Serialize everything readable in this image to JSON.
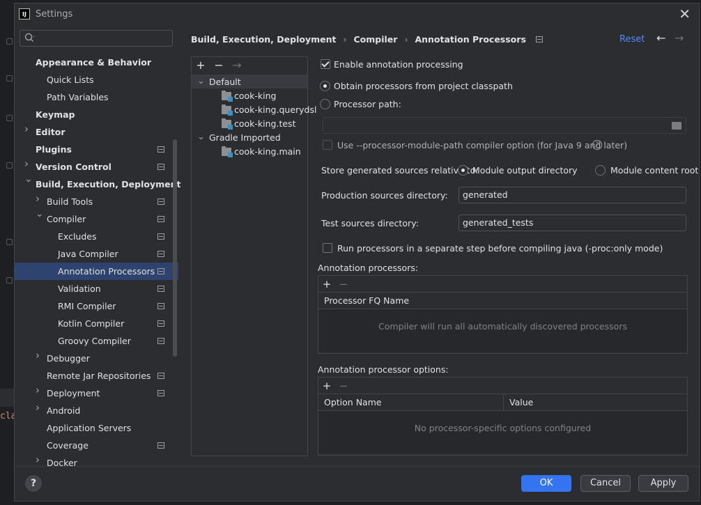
{
  "background_edge": {
    "code_snippet": "cla"
  },
  "window": {
    "title": "Settings",
    "app_icon_text": "IJ"
  },
  "sidebar": {
    "search": {
      "value": "",
      "placeholder": ""
    },
    "items": [
      {
        "label": "Appearance & Behavior",
        "level": 0,
        "bold": true,
        "chevron": "none"
      },
      {
        "label": "Quick Lists",
        "level": 1
      },
      {
        "label": "Path Variables",
        "level": 1
      },
      {
        "label": "Keymap",
        "level": 0,
        "bold": true
      },
      {
        "label": "Editor",
        "level": 0,
        "bold": true,
        "chevron": "right"
      },
      {
        "label": "Plugins",
        "level": 0,
        "bold": true,
        "project_icon": true
      },
      {
        "label": "Version Control",
        "level": 0,
        "bold": true,
        "chevron": "right",
        "project_icon": true
      },
      {
        "label": "Build, Execution, Deployment",
        "level": 0,
        "bold": true,
        "chevron": "down"
      },
      {
        "label": "Build Tools",
        "level": 1,
        "chevron": "right",
        "project_icon": true
      },
      {
        "label": "Compiler",
        "level": 1,
        "chevron": "down",
        "project_icon": true
      },
      {
        "label": "Excludes",
        "level": 2,
        "project_icon": true
      },
      {
        "label": "Java Compiler",
        "level": 2,
        "project_icon": true
      },
      {
        "label": "Annotation Processors",
        "level": 2,
        "project_icon": true,
        "selected": true
      },
      {
        "label": "Validation",
        "level": 2,
        "project_icon": true
      },
      {
        "label": "RMI Compiler",
        "level": 2,
        "project_icon": true
      },
      {
        "label": "Kotlin Compiler",
        "level": 2,
        "project_icon": true
      },
      {
        "label": "Groovy Compiler",
        "level": 2,
        "project_icon": true
      },
      {
        "label": "Debugger",
        "level": 1,
        "chevron": "right"
      },
      {
        "label": "Remote Jar Repositories",
        "level": 1,
        "project_icon": true
      },
      {
        "label": "Deployment",
        "level": 1,
        "chevron": "right",
        "project_icon": true
      },
      {
        "label": "Android",
        "level": 1,
        "chevron": "right"
      },
      {
        "label": "Application Servers",
        "level": 1
      },
      {
        "label": "Coverage",
        "level": 1,
        "project_icon": true
      },
      {
        "label": "Docker",
        "level": 1,
        "chevron": "right"
      }
    ]
  },
  "header": {
    "breadcrumbs": [
      "Build, Execution, Deployment",
      "Compiler",
      "Annotation Processors"
    ],
    "reset_label": "Reset"
  },
  "modules": {
    "items": [
      {
        "label": "Default",
        "type": "group",
        "expanded": true,
        "selected": true
      },
      {
        "label": "cook-king",
        "type": "module"
      },
      {
        "label": "cook-king.querydsl",
        "type": "module"
      },
      {
        "label": "cook-king.test",
        "type": "module"
      },
      {
        "label": "Gradle Imported",
        "type": "group",
        "expanded": true
      },
      {
        "label": "cook-king.main",
        "type": "module"
      }
    ]
  },
  "settings": {
    "enable_processing": {
      "label": "Enable annotation processing",
      "checked": true
    },
    "obtain_from_classpath": {
      "label": "Obtain processors from project classpath",
      "selected": true
    },
    "processor_path": {
      "label": "Processor path:",
      "selected": false,
      "value": ""
    },
    "module_path_option": {
      "label": "Use --processor-module-path compiler option (for Java 9 and later)",
      "checked": false,
      "enabled": false
    },
    "store_relative_label": "Store generated sources relative to:",
    "store_options": [
      {
        "label": "Module output directory",
        "selected": true
      },
      {
        "label": "Module content root",
        "selected": false
      }
    ],
    "production_dir": {
      "label": "Production sources directory:",
      "value": "generated"
    },
    "test_dir": {
      "label": "Test sources directory:",
      "value": "generated_tests"
    },
    "separate_step": {
      "label": "Run processors in a separate step before compiling java (-proc:only mode)",
      "checked": false
    }
  },
  "processors_table": {
    "label": "Annotation processors:",
    "columns": [
      "Processor FQ Name"
    ],
    "empty_text": "Compiler will run all automatically discovered processors"
  },
  "options_table": {
    "label": "Annotation processor options:",
    "columns": [
      "Option Name",
      "Value"
    ],
    "empty_text": "No processor-specific options configured"
  },
  "footer": {
    "help_label": "?",
    "ok_label": "OK",
    "cancel_label": "Cancel",
    "apply_label": "Apply"
  },
  "colors": {
    "selection": "#2e436e",
    "accent": "#3574f0",
    "link": "#548af7",
    "dialog_bg": "#2b2d30"
  }
}
